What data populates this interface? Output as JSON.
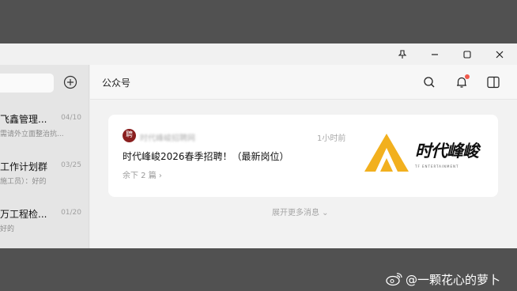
{
  "titlebar": {
    "pin_icon": "pin-icon",
    "minimize_icon": "minimize-icon",
    "maximize_icon": "maximize-icon",
    "close_icon": "close-icon"
  },
  "sidebar": {
    "items": [
      {
        "title": "飞鑫管理...",
        "date": "04/10",
        "preview": "需请外立面整治抗..."
      },
      {
        "title": "工作计划群",
        "date": "03/25",
        "preview": "施工员）：好的"
      },
      {
        "title": "万工程检...",
        "date": "01/20",
        "preview": "好的"
      }
    ]
  },
  "main": {
    "title": "公众号",
    "icons": [
      "search-icon",
      "bell-icon",
      "sidebar-toggle-icon"
    ]
  },
  "card": {
    "avatar_text": "聘",
    "account": "时代峰峻招聘网",
    "time": "1小时前",
    "title": "时代峰峻2026春季招聘！（最新岗位）",
    "more": "余下 2 篇 ›",
    "thumb_title": "时代峰峻",
    "thumb_subtitle": "TF ENTERTAINMENT",
    "brand_color": "#f2b01e"
  },
  "expand_label": "展开更多消息 ⌄",
  "watermark": "@一颗花心的萝卜"
}
